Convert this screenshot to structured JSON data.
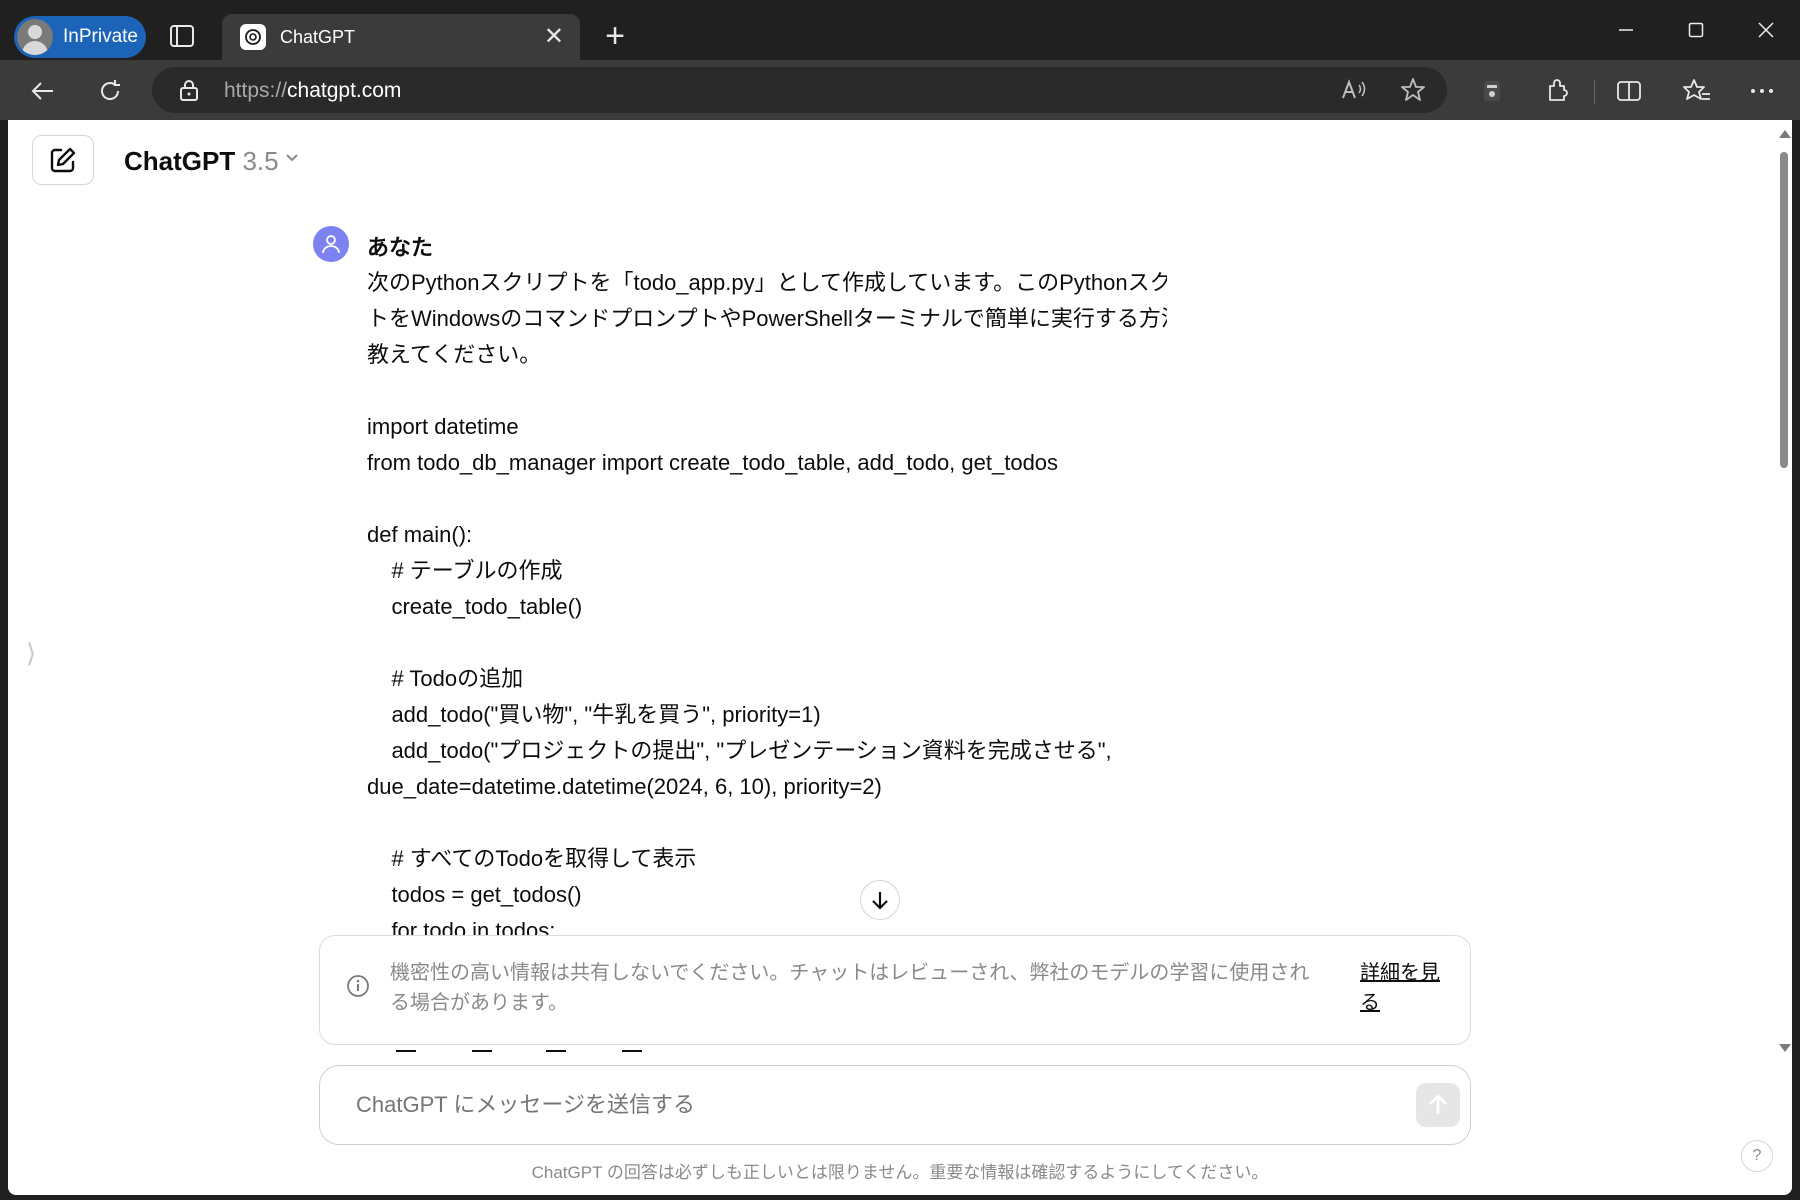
{
  "browser": {
    "profile_label": "InPrivate",
    "tab_title": "ChatGPT",
    "tab_close": "✕",
    "new_tab": "+",
    "url_scheme": "https://",
    "url_host": "chatgpt.com"
  },
  "header": {
    "model_name": "ChatGPT",
    "model_version": "3.5"
  },
  "message": {
    "author": "あなた",
    "lines": [
      "次のPythonスクリプトを「todo_app.py」として作成しています。このPythonスクリプ",
      "トをWindowsのコマンドプロンプトやPowerShellターミナルで簡単に実行する方法を",
      "教えてください。",
      "",
      "import datetime",
      "from todo_db_manager import create_todo_table, add_todo, get_todos",
      "",
      "def main():",
      "    # テーブルの作成",
      "    create_todo_table()",
      "",
      "    # Todoの追加",
      "    add_todo(\"買い物\", \"牛乳を買う\", priority=1)",
      "    add_todo(\"プロジェクトの提出\", \"プレゼンテーション資料を完成させる\",",
      "due_date=datetime.datetime(2024, 6, 10), priority=2)",
      "",
      "    # すべてのTodoを取得して表示",
      "    todos = get_todos()",
      "    for todo in todos:"
    ]
  },
  "disclaimer": {
    "text": "機密性の高い情報は共有しないでください。チャットはレビューされ、弊社のモデルの学習に使用される場合があります。",
    "link": "詳細を見る"
  },
  "composer": {
    "placeholder": "ChatGPT にメッセージを送信する"
  },
  "footer": {
    "note": "ChatGPT の回答は必ずしも正しいとは限りません。重要な情報は確認するようにしてください。",
    "help": "?"
  },
  "colors": {
    "inprivate": "#1c64b8",
    "avatar": "#7c83f0",
    "chrome_bg": "#202020",
    "toolbar_bg": "#3b3b3b"
  }
}
